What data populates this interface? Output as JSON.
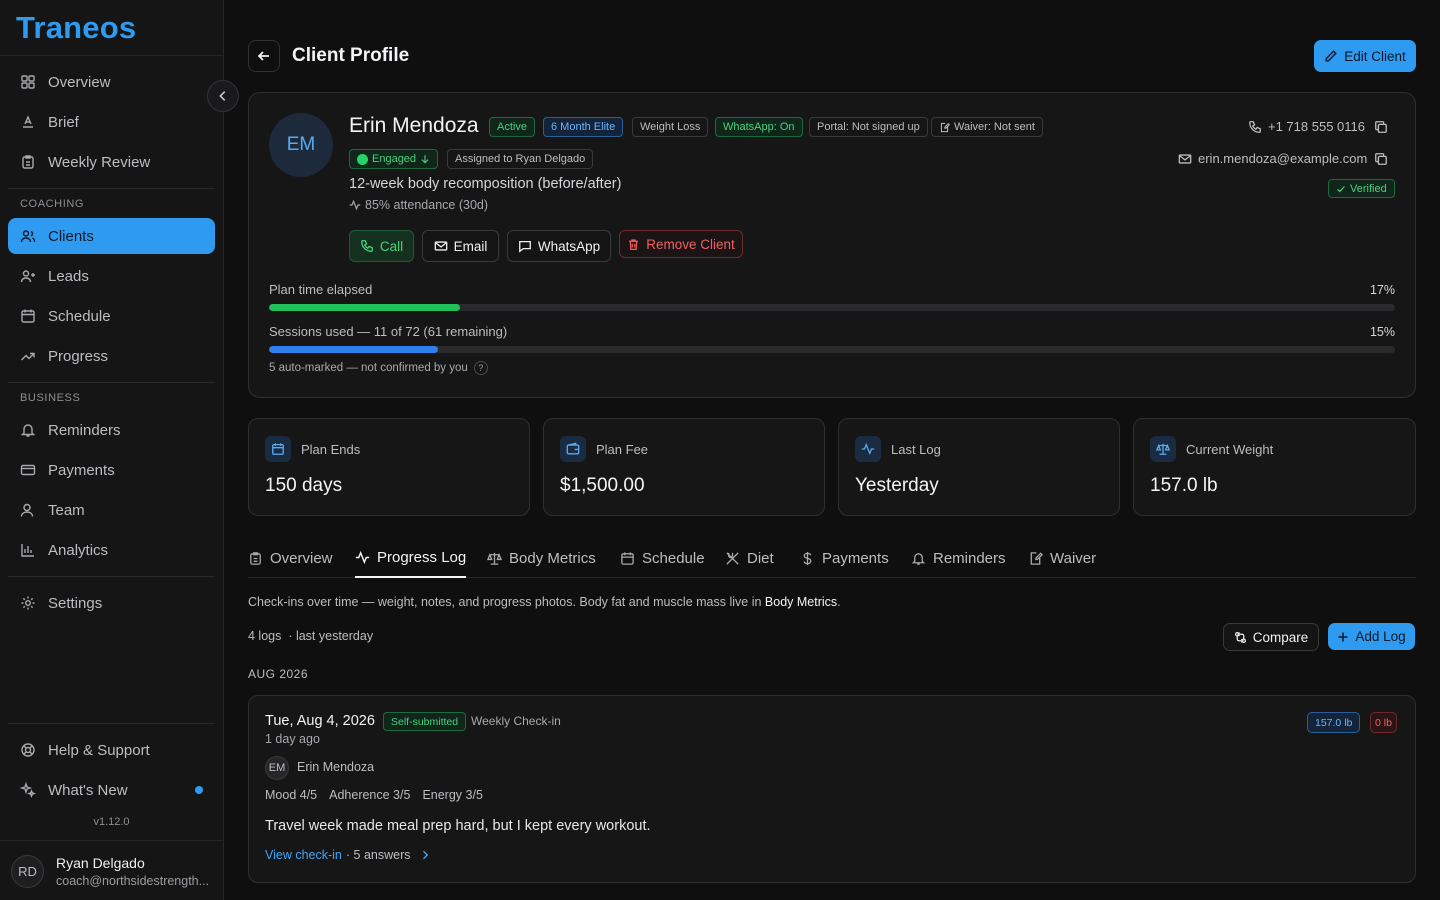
{
  "app": {
    "logo": "Traneos",
    "version": "v1.12.0"
  },
  "sidebar": {
    "items_top": [
      {
        "label": "Overview",
        "icon": "grid-icon"
      },
      {
        "label": "Brief",
        "icon": "brief-icon"
      },
      {
        "label": "Weekly Review",
        "icon": "clipboard-icon"
      }
    ],
    "section_coaching": "COACHING",
    "items_coaching": [
      {
        "label": "Clients",
        "icon": "users-icon",
        "active": true
      },
      {
        "label": "Leads",
        "icon": "user-plus-icon"
      },
      {
        "label": "Schedule",
        "icon": "calendar-icon"
      },
      {
        "label": "Progress",
        "icon": "trending-up-icon"
      }
    ],
    "section_business": "BUSINESS",
    "items_business": [
      {
        "label": "Reminders",
        "icon": "bell-icon"
      },
      {
        "label": "Payments",
        "icon": "card-icon"
      },
      {
        "label": "Team",
        "icon": "team-icon"
      },
      {
        "label": "Analytics",
        "icon": "bar-chart-icon"
      }
    ],
    "settings": "Settings",
    "help": "Help & Support",
    "whats_new": "What's New",
    "user": {
      "initials": "RD",
      "name": "Ryan Delgado",
      "email": "coach@northsidestrength..."
    }
  },
  "header": {
    "title": "Client Profile",
    "edit_label": "Edit Client"
  },
  "client": {
    "initials": "EM",
    "name": "Erin Mendoza",
    "badges": [
      "Active",
      "6 Month Elite",
      "Weight Loss",
      "WhatsApp: On",
      "Portal: Not signed up",
      "Waiver: Not sent"
    ],
    "engaged": "Engaged",
    "assigned": "Assigned to Ryan Delgado",
    "goal": "12-week body recomposition (before/after)",
    "attendance": "85% attendance (30d)",
    "phone": "+1 718 555 0116",
    "email": "erin.mendoza@example.com",
    "verified": "Verified",
    "actions": {
      "call": "Call",
      "email": "Email",
      "whatsapp": "WhatsApp",
      "remove": "Remove Client"
    }
  },
  "progress": {
    "plan_label": "Plan time elapsed",
    "plan_pct_text": "17%",
    "plan_fraction": 0.17,
    "sessions_label": "Sessions used — 11 of 72 (61 remaining)",
    "sessions_pct_text": "15%",
    "sessions_fraction": 0.15,
    "auto_note": "5 auto-marked — not confirmed by you",
    "colors": {
      "plan": "#1fc25a",
      "sessions": "#2f7ff0"
    }
  },
  "stats": [
    {
      "label": "Plan Ends",
      "value": "150 days",
      "icon": "calendar-icon"
    },
    {
      "label": "Plan Fee",
      "value": "$1,500.00",
      "icon": "wallet-icon"
    },
    {
      "label": "Last Log",
      "value": "Yesterday",
      "icon": "activity-icon"
    },
    {
      "label": "Current Weight",
      "value": "157.0 lb",
      "icon": "scale-icon"
    }
  ],
  "tabs": [
    {
      "label": "Overview",
      "icon": "clipboard-icon"
    },
    {
      "label": "Progress Log",
      "icon": "activity-icon",
      "active": true
    },
    {
      "label": "Body Metrics",
      "icon": "scale-icon"
    },
    {
      "label": "Schedule",
      "icon": "calendar-icon"
    },
    {
      "label": "Diet",
      "icon": "utensils-icon"
    },
    {
      "label": "Payments",
      "icon": "dollar-icon"
    },
    {
      "label": "Reminders",
      "icon": "bell-icon"
    },
    {
      "label": "Waiver",
      "icon": "edit-doc-icon"
    }
  ],
  "log_section": {
    "desc_prefix": "Check-ins over time — weight, notes, and progress photos. Body fat and muscle mass live in ",
    "desc_link": "Body Metrics",
    "desc_suffix": ".",
    "count": "4 logs",
    "last": "· last yesterday",
    "compare_label": "Compare",
    "add_label": "Add Log",
    "month": "AUG 2026"
  },
  "log_entry": {
    "date": "Tue, Aug 4, 2026",
    "source_badge": "Self-submitted",
    "type": "Weekly Check-in",
    "ago": "1 day ago",
    "author_initials": "EM",
    "author": "Erin Mendoza",
    "ratings": [
      "Mood 4/5",
      "Adherence 3/5",
      "Energy 3/5"
    ],
    "note": "Travel week made meal prep hard, but I kept every workout.",
    "weight_badge": "157.0 lb",
    "delta_badge": "0 lb",
    "view_link": "View check-in",
    "answers": "· 5 answers"
  }
}
